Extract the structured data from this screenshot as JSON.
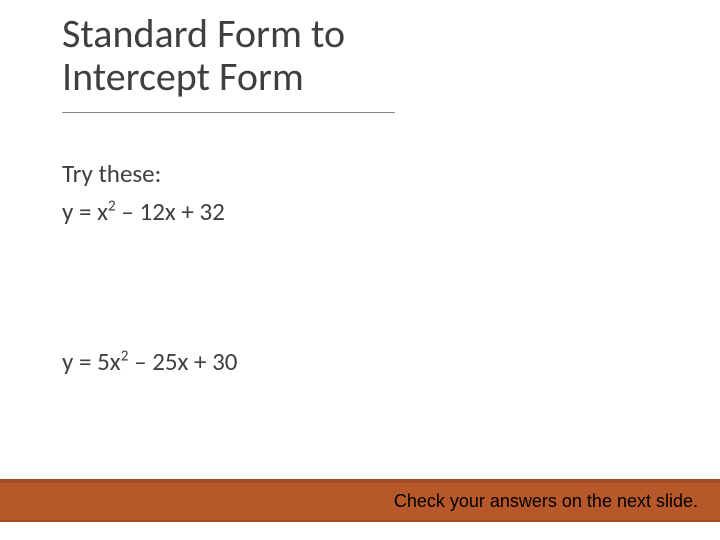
{
  "title_line1": "Standard Form to",
  "title_line2": "Intercept Form",
  "prompt": "Try these:",
  "eq1": {
    "pre": "y = x",
    "sup": "2",
    "post": " – 12x + 32"
  },
  "eq2": {
    "pre": "y = 5x",
    "sup": "2",
    "post": " – 25x + 30"
  },
  "footer": "Check your answers on the next slide."
}
